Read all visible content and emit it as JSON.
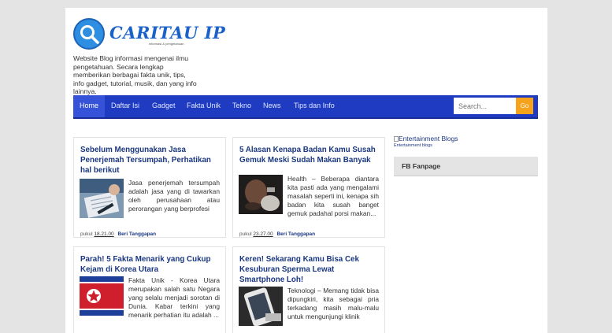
{
  "header": {
    "title": "CARITAU IP",
    "subtitle": "informasi & pengetahuan",
    "description": "Website Blog informasi mengenai ilmu pengetahuan. Secara lengkap memberikan berbagai fakta unik, tips, info gadget, tutorial, musik, dan yang info lainnya."
  },
  "nav": {
    "items": [
      "Home",
      "Daftar Isi",
      "Gadget",
      "Fakta Unik",
      "Tekno",
      "News",
      "Tips dan Info"
    ],
    "search_placeholder": "Search...",
    "search_button": "Go"
  },
  "posts": [
    {
      "title": "Sebelum Menggunakan Jasa Penerjemah Tersumpah, Perhatikan hal berikut",
      "snippet": "Jasa penerjemah tersumpah adalah jasa yang di tawarkan oleh perusahaan atau perorangan yang berprofesi",
      "meta_prefix": "pukul",
      "time": "18.21.00",
      "comments": "Beri Tanggapan"
    },
    {
      "title": "5 Alasan Kenapa Badan Kamu Susah Gemuk Meski Sudah Makan Banyak",
      "snippet": "Health – Beberapa diantara kita pasti ada yang mengalami masalah seperti ini, kenapa sih badan kita susah banget gemuk padahal porsi makan...",
      "meta_prefix": "pukul",
      "time": "23.27.00",
      "comments": "Beri Tanggapan"
    },
    {
      "title": "Parah! 5 Fakta Menarik yang Cukup Kejam di Korea Utara",
      "snippet": "Fakta Unik - Korea Utara merupakan salah satu Negara yang selalu menjadi sorotan di Dunia. Kabar terkini yang menarik perhatian itu adalah ...",
      "meta_prefix": "",
      "time": "",
      "comments": ""
    },
    {
      "title": "Keren! Sekarang Kamu Bisa Cek Kesuburan Sperma Lewat Smartphone Loh!",
      "snippet": "Teknologi – Memang tidak bisa dipungkiri, kita sebagai pria terkadang masih malu-malu untuk mengunjungi klinik",
      "meta_prefix": "",
      "time": "",
      "comments": ""
    }
  ],
  "sidebar": {
    "badge_alt": "Entertainment Blogs",
    "badge_caption": "Entertainment blogs",
    "fb_title": "FB Fanpage"
  },
  "colors": {
    "nav_bg": "#1f3bc2",
    "accent_orange": "#f7a21b",
    "title_blue": "#1a3780",
    "page_bg": "#e4e4e4"
  }
}
